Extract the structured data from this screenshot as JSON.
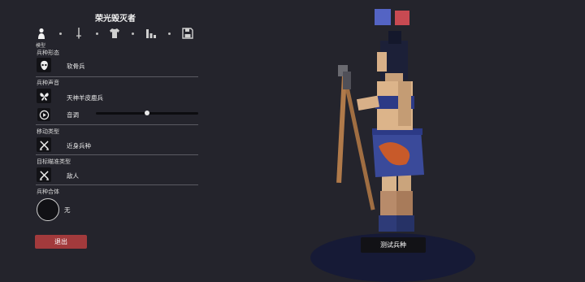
{
  "panel": {
    "title": "荣光毁灭者",
    "tabs": [
      {
        "name": "unit-tab",
        "icon": "person-icon",
        "label": "模型"
      },
      {
        "name": "weapon-tab",
        "icon": "sword-icon"
      },
      {
        "name": "armor-tab",
        "icon": "shirt-icon"
      },
      {
        "name": "stats-tab",
        "icon": "bar-chart-icon"
      },
      {
        "name": "save-tab",
        "icon": "floppy-disk-icon"
      }
    ],
    "active_tab_label": "模型",
    "sections": {
      "form": {
        "label": "兵种形态",
        "value": "软骨兵"
      },
      "voice": {
        "label": "兵种声音",
        "value": "天神羊皮鹿兵",
        "pitch_label": "音调",
        "pitch_level": 0.5
      },
      "movement": {
        "label": "移动类型",
        "value": "近身兵种"
      },
      "targeting": {
        "label": "目标瞄准类型",
        "value": "敌人"
      },
      "fusion": {
        "label": "兵种合体",
        "value": "无"
      }
    },
    "exit_label": "退出"
  },
  "viewport": {
    "color_swatches": [
      "#5464c4",
      "#c84a52"
    ],
    "test_button_label": "测试兵种"
  }
}
